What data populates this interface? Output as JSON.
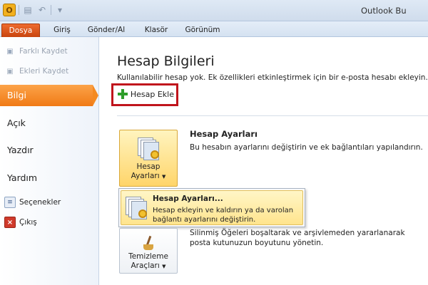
{
  "window": {
    "title": "Outlook Bu",
    "app_icon_letter": "O"
  },
  "tabs": [
    {
      "label": "Dosya"
    },
    {
      "label": "Giriş"
    },
    {
      "label": "Gönder/Al"
    },
    {
      "label": "Klasör"
    },
    {
      "label": "Görünüm"
    }
  ],
  "nav": {
    "save_as": "Farklı Kaydet",
    "save_attachments": "Ekleri Kaydet",
    "info": "Bilgi",
    "open": "Açık",
    "print": "Yazdır",
    "help": "Yardım",
    "options": "Seçenekler",
    "exit": "Çıkış"
  },
  "main": {
    "title": "Hesap Bilgileri",
    "description": "Kullanılabilir hesap yok. Ek özellikleri etkinleştirmek için bir e-posta hesabı ekleyin.",
    "add_account_label": "Hesap Ekle",
    "account_settings": {
      "button_line1": "Hesap",
      "button_line2": "Ayarları",
      "title": "Hesap Ayarları",
      "description": "Bu hesabın ayarlarını değiştirin ve ek bağlantıları yapılandırın."
    },
    "menu": {
      "item_title": "Hesap Ayarları...",
      "item_description": "Hesap ekleyin ve kaldırın ya da varolan bağlantı ayarlarını değiştirin."
    },
    "cleanup": {
      "button_line1": "Temizleme",
      "button_line2": "Araçları",
      "description": "Silinmiş Öğeleri boşaltarak ve arşivlemeden yararlanarak posta kutunuzun boyutunu yönetin."
    }
  },
  "colors": {
    "file_tab": "#d45418",
    "nav_selected": "#f48a22",
    "highlight_box": "#c0141c",
    "plus_icon": "#2e9d2a"
  }
}
